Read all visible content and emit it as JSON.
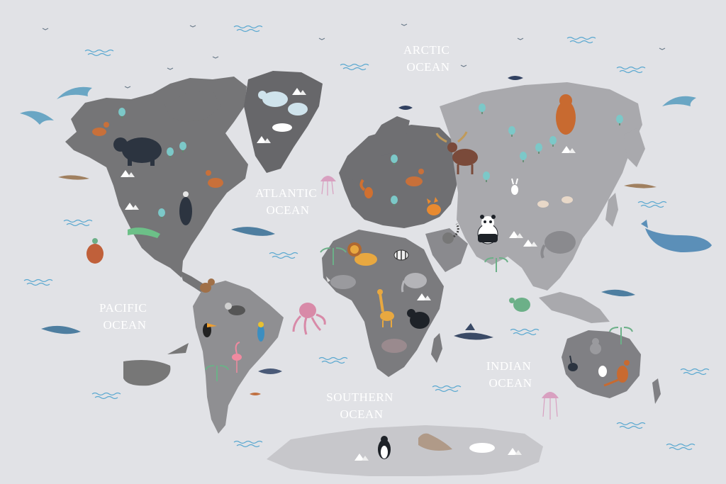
{
  "map": {
    "background": "#e1e2e6",
    "colors": {
      "north_america": "#757577",
      "greenland": "#67676a",
      "south_america": "#8f8f92",
      "europe": "#6f6f72",
      "africa": "#7b7b7e",
      "asia": "#a9a9ad",
      "australia": "#808084",
      "antarctica": "#c7c7cb",
      "wave": "#5aa8d0",
      "tree": "#7cc8c8",
      "mountain": "#ffffff"
    },
    "oceans": [
      {
        "id": "arctic",
        "lines": [
          "ARCTIC",
          "OCEAN"
        ]
      },
      {
        "id": "atlantic",
        "lines": [
          "ATLANTIC",
          "OCEAN"
        ]
      },
      {
        "id": "pacific",
        "lines": [
          "PACIFIC",
          "OCEAN"
        ]
      },
      {
        "id": "indian",
        "lines": [
          "INDIAN",
          "OCEAN"
        ]
      },
      {
        "id": "southern",
        "lines": [
          "SOUTHERN",
          "OCEAN"
        ]
      }
    ],
    "animals": [
      "dolphin",
      "bear",
      "deer",
      "cougar",
      "vulture",
      "crocodile",
      "sea-turtle",
      "shark",
      "whale",
      "monkey",
      "toucan",
      "raccoon",
      "parrot",
      "flamingo",
      "sperm-whale",
      "tuna",
      "lion",
      "zebra",
      "rhino",
      "elephant",
      "giraffe",
      "gorilla",
      "hippo",
      "octopus",
      "jellyfish",
      "squirrel",
      "fox",
      "moose",
      "brown-bear",
      "rabbit",
      "panda",
      "lemur",
      "asian-elephant",
      "kangaroo",
      "koala",
      "emu",
      "penguin",
      "seal",
      "polar-bear",
      "swordfish"
    ]
  }
}
